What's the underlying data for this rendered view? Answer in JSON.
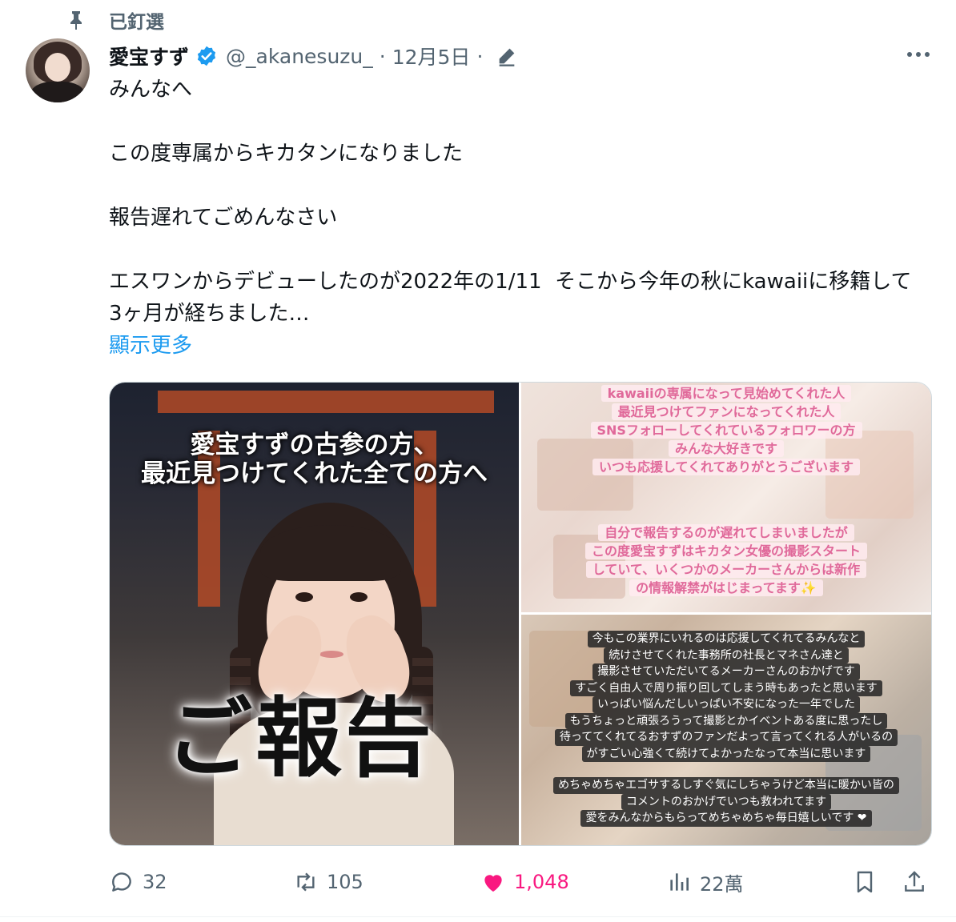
{
  "pinned": {
    "label": "已釘選"
  },
  "tweet": {
    "display_name": "愛宝すず",
    "handle": "@_akanesuzu_",
    "separator": "·",
    "date": "12月5日",
    "text": "みんなへ\n\nこの度専属からキカタンになりました\n\n報告遅れてごめんなさい\n\nエスワンからデビューしたのが2022年の1/11  そこから今年の秋にkawaiiに移籍して3ヶ月が経ちました…",
    "show_more": "顯示更多"
  },
  "media": {
    "main_image": {
      "caption_line1": "愛宝すずの古参の方、",
      "caption_line2": "最近見つけてくれた全ての方へ",
      "title": "ご報告"
    },
    "top_right_image": {
      "lines_top": [
        "kawaiiの専属になって見始めてくれた人",
        "最近見つけてファンになってくれた人",
        "SNSフォローしてくれているフォロワーの方",
        "みんな大好きです",
        "いつも応援してくれてありがとうございます"
      ],
      "lines_bottom": [
        "自分で報告するのが遅れてしまいましたが",
        "この度愛宝すずはキカタン女優の撮影スタート",
        "していて、いくつかのメーカーさんからは新作",
        "の情報解禁がはじまってます✨"
      ]
    },
    "bottom_right_image": {
      "lines_top": [
        "今もこの業界にいれるのは応援してくれてるみんなと",
        "続けさせてくれた事務所の社長とマネさん達と",
        "撮影させていただいてるメーカーさんのおかげです",
        "すごく自由人で周り振り回してしまう時もあったと思います",
        "いっぱい悩んだしいっぱい不安になった一年でした",
        "もうちょっと頑張ろうって撮影とかイベントある度に思ったし",
        "待っててくれてるおすずのファンだよって言ってくれる人がいるの",
        "がすごい心強くて続けてよかったなって本当に思います"
      ],
      "lines_bottom": [
        "めちゃめちゃエゴサするしすぐ気にしちゃうけど本当に暖かい皆の",
        "コメントのおかげでいつも救われてます",
        "愛をみんなからもらってめちゃめちゃ毎日嬉しいです ❤"
      ]
    }
  },
  "actions": {
    "replies": "32",
    "reposts": "105",
    "likes": "1,048",
    "views": "22萬"
  },
  "colors": {
    "accent": "#1d9bf0",
    "like": "#f91880",
    "secondary_text": "#536471"
  },
  "icons": [
    "pin-icon",
    "verified-icon",
    "edit-icon",
    "more-icon",
    "reply-icon",
    "repost-icon",
    "like-icon",
    "views-icon",
    "bookmark-icon",
    "share-icon"
  ]
}
